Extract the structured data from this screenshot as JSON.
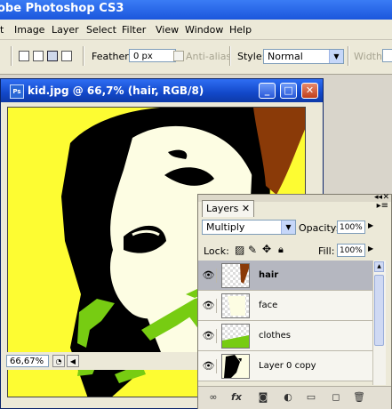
{
  "app": {
    "title": "obe Photoshop CS3"
  },
  "menu": [
    "t",
    "Image",
    "Layer",
    "Select",
    "Filter",
    "View",
    "Window",
    "Help"
  ],
  "options": {
    "feather_label": "Feather:",
    "feather_value": "0 px",
    "antialias_label": "Anti-alias",
    "style_label": "Style:",
    "style_value": "Normal",
    "width_label": "Width:"
  },
  "document": {
    "title": "kid.jpg @ 66,7% (hair, RGB/8)",
    "zoom": "66,67%",
    "ps_badge": "Ps",
    "minimize_icon": "_",
    "restore_icon": "□",
    "close_icon": "✕"
  },
  "layers_panel": {
    "tab_label": "Layers",
    "blend_mode": "Multiply",
    "opacity_label": "Opacity:",
    "opacity_value": "100%",
    "lock_label": "Lock:",
    "fill_label": "Fill:",
    "fill_value": "100%",
    "layers": [
      {
        "name": "hair",
        "selected": true
      },
      {
        "name": "face",
        "selected": false
      },
      {
        "name": "clothes",
        "selected": false
      },
      {
        "name": "Layer 0 copy",
        "selected": false
      }
    ],
    "bottom_icons": [
      "link-icon",
      "fx-icon",
      "mask-icon",
      "adjustment-icon",
      "folder-icon",
      "new-layer-icon",
      "trash-icon"
    ]
  },
  "colors": {
    "canvas_yellow": "#fdfc32",
    "canvas_cream": "#fdfde3",
    "hair_brown": "#8a3a08",
    "clothes_green": "#77cc12"
  }
}
